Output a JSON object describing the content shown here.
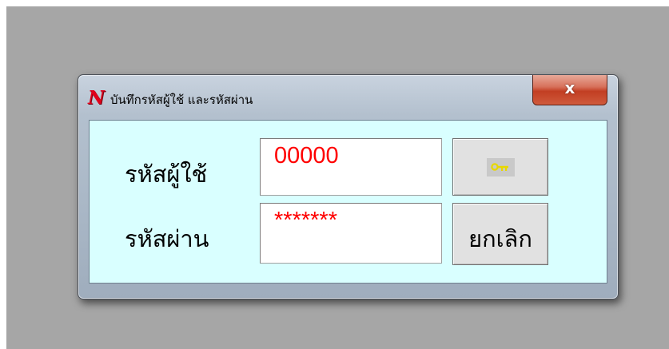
{
  "window": {
    "title": "บันทึกรหัสผู้ใช้ และรหัสผ่าน",
    "close_label": "x"
  },
  "form": {
    "user_label": "รหัสผู้ใช้",
    "user_value": "00000",
    "password_label": "รหัสผ่าน",
    "password_value": "*******",
    "login_icon": "key-icon",
    "cancel_label": "ยกเลิก"
  },
  "colors": {
    "client_background": "#d9ffff",
    "field_text": "#ff0000",
    "app_icon": "#e0001b",
    "key": "#e8d800"
  }
}
